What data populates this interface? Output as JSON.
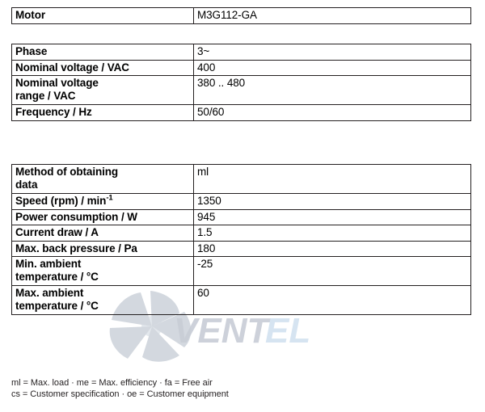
{
  "document": {
    "background_color": "#ffffff",
    "text_color": "#000000",
    "border_color": "#231f20"
  },
  "watermark": {
    "text": "VENTEL",
    "text_part_1": "VENT",
    "text_part_2": "EL",
    "color_dark": "#c8cdd6",
    "color_light": "#d7e4f2",
    "icon": "fan-impeller-icon"
  },
  "tables": [
    {
      "id": "motor",
      "name": "motor-table",
      "rows": [
        {
          "label": "Motor",
          "value": "M3G112-GA",
          "lines": 1
        }
      ]
    },
    {
      "id": "supply",
      "name": "power-supply-table",
      "rows": [
        {
          "label": "Phase",
          "value": "3~",
          "lines": 1
        },
        {
          "label": "Nominal voltage / VAC",
          "value": "400",
          "lines": 1
        },
        {
          "label": "Nominal voltage range / VAC",
          "label_line_1": "Nominal voltage",
          "label_line_2": "range / VAC",
          "value": "380 .. 480",
          "lines": 2
        },
        {
          "label": "Frequency / Hz",
          "value": "50/60",
          "lines": 1
        }
      ]
    },
    {
      "id": "performance",
      "name": "performance-table",
      "rows": [
        {
          "label": "Method of obtaining data",
          "label_line_1": "Method of obtaining",
          "label_line_2": "data",
          "value": "ml",
          "lines": 2
        },
        {
          "label": "Speed (rpm) / min-1",
          "label_prefix": "Speed (rpm) / min",
          "label_superscript": "-1",
          "value": "1350",
          "lines": 1
        },
        {
          "label": "Power consumption / W",
          "value": "945",
          "lines": 1
        },
        {
          "label": "Current draw / A",
          "value": "1.5",
          "lines": 1
        },
        {
          "label": "Max. back pressure / Pa",
          "value": "180",
          "lines": 1
        },
        {
          "label": "Min. ambient temperature / °C",
          "label_line_1": "Min. ambient",
          "label_line_2": "temperature / °C",
          "value": "-25",
          "lines": 2
        },
        {
          "label": "Max. ambient temperature / °C",
          "label_line_1": "Max. ambient",
          "label_line_2": "temperature / °C",
          "value": "60",
          "lines": 2
        }
      ]
    }
  ],
  "legend": {
    "line_1": "ml = Max. load · me = Max. efficiency · fa = Free air",
    "line_2": "cs = Customer specification · oe = Customer equipment"
  }
}
